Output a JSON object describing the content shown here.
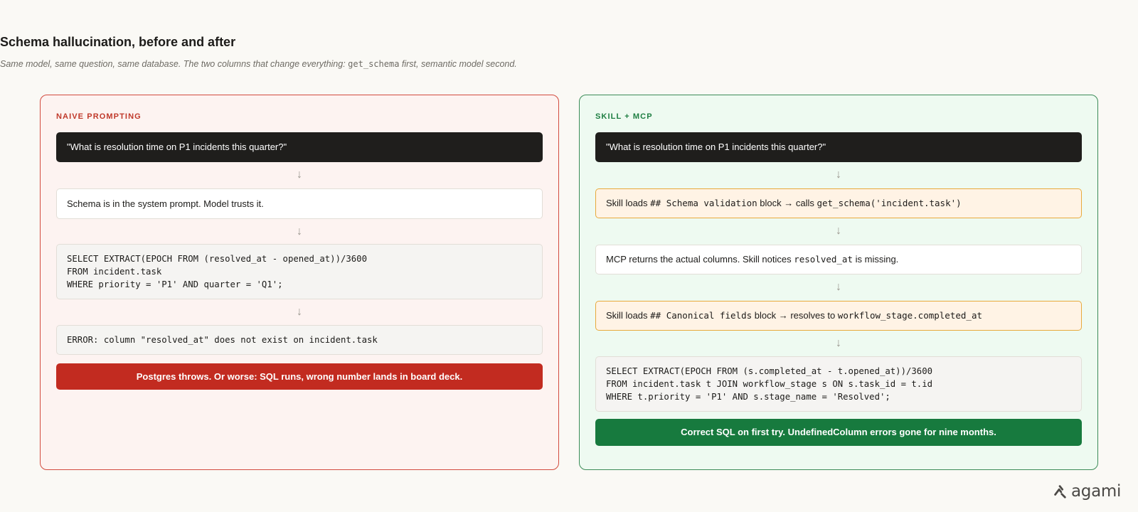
{
  "header": {
    "title": "Schema hallucination, before and after",
    "subtitle_pre": "Same model, same question, same database. The two columns that change everything: ",
    "subtitle_code": "get_schema",
    "subtitle_post": " first, semantic model second."
  },
  "left": {
    "label": "NAIVE PROMPTING",
    "question": "\"What is resolution time on P1 incidents this quarter?\"",
    "step_prompt": "Schema is in the system prompt. Model trusts it.",
    "sql": "SELECT EXTRACT(EPOCH FROM (resolved_at - opened_at))/3600\nFROM incident.task\nWHERE priority = 'P1' AND quarter = 'Q1';",
    "error": "ERROR: column \"resolved_at\" does not exist on incident.task",
    "outcome": "Postgres throws. Or worse: SQL runs, wrong number lands in board deck."
  },
  "right": {
    "label": "SKILL + MCP",
    "question": "\"What is resolution time on P1 incidents this quarter?\"",
    "step1_a": "Skill loads ",
    "step1_code1": "## Schema validation",
    "step1_b": " block → calls ",
    "step1_code2": "get_schema('incident.task')",
    "step2_a": "MCP returns the actual columns. Skill notices ",
    "step2_code": "resolved_at",
    "step2_b": " is missing.",
    "step3_a": "Skill loads ",
    "step3_code1": "## Canonical fields",
    "step3_b": " block → resolves to ",
    "step3_code2": "workflow_stage.completed_at",
    "sql": "SELECT EXTRACT(EPOCH FROM (s.completed_at - t.opened_at))/3600\nFROM incident.task t JOIN workflow_stage s ON s.task_id = t.id\nWHERE t.priority = 'P1' AND s.stage_name = 'Resolved';",
    "outcome": "Correct SQL on first try. UndefinedColumn errors gone for nine months."
  },
  "icons": {
    "flow_arrow": "↓",
    "logo": "agami-logo-icon"
  },
  "brand": {
    "name": "agami"
  },
  "colors": {
    "naive_accent": "#c22b20",
    "skill_accent": "#177a3e",
    "highlight": "#e8a93c"
  }
}
